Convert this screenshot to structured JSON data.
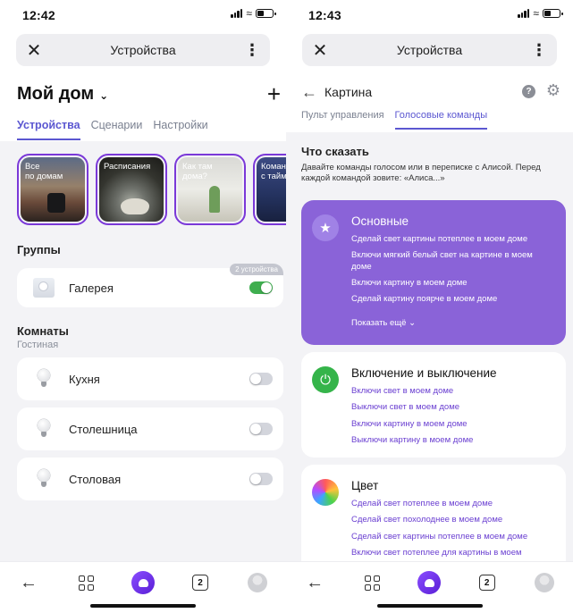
{
  "left": {
    "status": {
      "time": "12:42"
    },
    "browser": {
      "title": "Устройства"
    },
    "home": {
      "title": "Мой дом"
    },
    "tabs": [
      {
        "label": "Устройства",
        "active": true
      },
      {
        "label": "Сценарии",
        "active": false
      },
      {
        "label": "Настройки",
        "active": false
      }
    ],
    "stories": [
      {
        "label": "Все\nпо домам"
      },
      {
        "label": "Расписания"
      },
      {
        "label": "Как там\nдома?"
      },
      {
        "label": "Команды\nс таймером"
      }
    ],
    "groups": {
      "title": "Группы",
      "items": [
        {
          "name": "Галерея",
          "badge": "2 устройства",
          "on": true
        }
      ]
    },
    "rooms": {
      "title": "Комнаты",
      "subtitle": "Гостиная",
      "items": [
        {
          "name": "Кухня",
          "on": false
        },
        {
          "name": "Столешница",
          "on": false
        },
        {
          "name": "Столовая",
          "on": false
        }
      ]
    },
    "nav": {
      "tabs_count": "2"
    }
  },
  "right": {
    "status": {
      "time": "12:43"
    },
    "browser": {
      "title": "Устройства"
    },
    "device": {
      "title": "Картина"
    },
    "tabs": [
      {
        "label": "Пульт управления",
        "active": false
      },
      {
        "label": "Голосовые команды",
        "active": true
      }
    ],
    "say": {
      "title": "Что сказать",
      "desc": "Давайте команды голосом или в переписке с Алисой. Перед каждой командой зовите: «Алиса...»"
    },
    "sections": [
      {
        "title": "Основные",
        "icon": "star-icon",
        "color": "#8a63d8",
        "commands": [
          "Сделай свет картины потеплее в моем доме",
          "Включи мягкий белый свет на картине в моем доме",
          "Включи картину в моем доме",
          "Сделай картину поярче в моем доме"
        ],
        "more": "Показать ещё"
      },
      {
        "title": "Включение и выключение",
        "icon": "power-icon",
        "commands": [
          "Включи свет в моем доме",
          "Выключи свет в моем доме",
          "Включи картину в моем доме",
          "Выключи картину в моем доме"
        ]
      },
      {
        "title": "Цвет",
        "icon": "palette-icon",
        "commands": [
          "Сделай свет потеплее в моем доме",
          "Сделай свет похолоднее в моем доме",
          "Сделай свет картины потеплее в моем доме",
          "Включи свет потеплее для картины в моем"
        ]
      }
    ],
    "nav": {
      "tabs_count": "2"
    }
  },
  "colors": {
    "accent": "#5b57d1",
    "alice": "#7a38d8",
    "toggle_on": "#3fae4f"
  }
}
